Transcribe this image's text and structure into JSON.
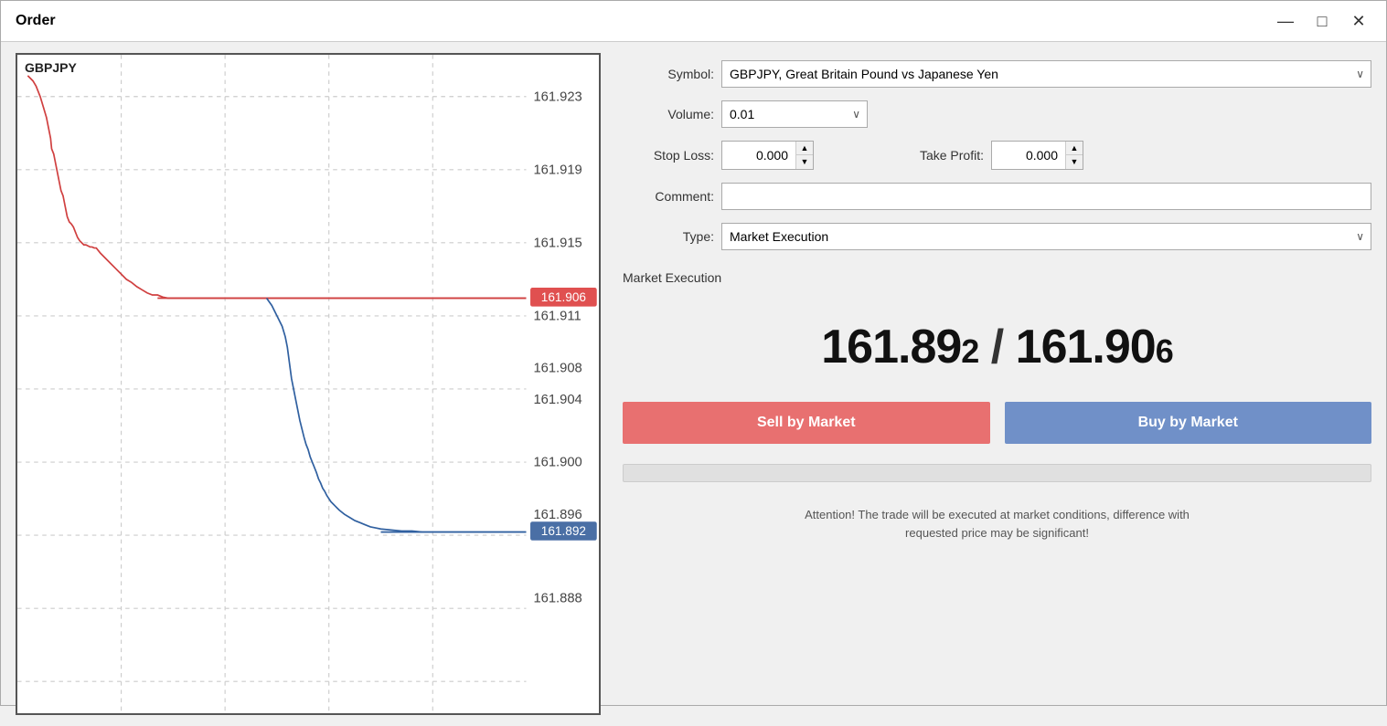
{
  "window": {
    "title": "Order",
    "controls": {
      "minimize": "—",
      "maximize": "□",
      "close": "✕"
    }
  },
  "chart": {
    "symbol_label": "GBPJPY",
    "price_ticks": [
      "161.923",
      "161.919",
      "161.915",
      "161.911",
      "161.908",
      "161.904",
      "161.900",
      "161.896",
      "161.888"
    ],
    "red_price": "161.906",
    "blue_price": "161.892"
  },
  "form": {
    "symbol_label": "Symbol:",
    "symbol_value": "GBPJPY, Great Britain Pound vs Japanese Yen",
    "volume_label": "Volume:",
    "volume_value": "0.01",
    "stop_loss_label": "Stop Loss:",
    "stop_loss_value": "0.000",
    "take_profit_label": "Take Profit:",
    "take_profit_value": "0.000",
    "comment_label": "Comment:",
    "comment_value": "",
    "type_label": "Type:",
    "type_value": "Market Execution",
    "section_header": "Market Execution",
    "bid_price": "161.892",
    "bid_suffix": "2",
    "ask_price": "161.906",
    "ask_suffix": "6",
    "price_separator": " / ",
    "sell_button": "Sell by Market",
    "buy_button": "Buy by Market",
    "attention_text": "Attention! The trade will be executed at market conditions, difference with\nrequested price may be significant!"
  }
}
